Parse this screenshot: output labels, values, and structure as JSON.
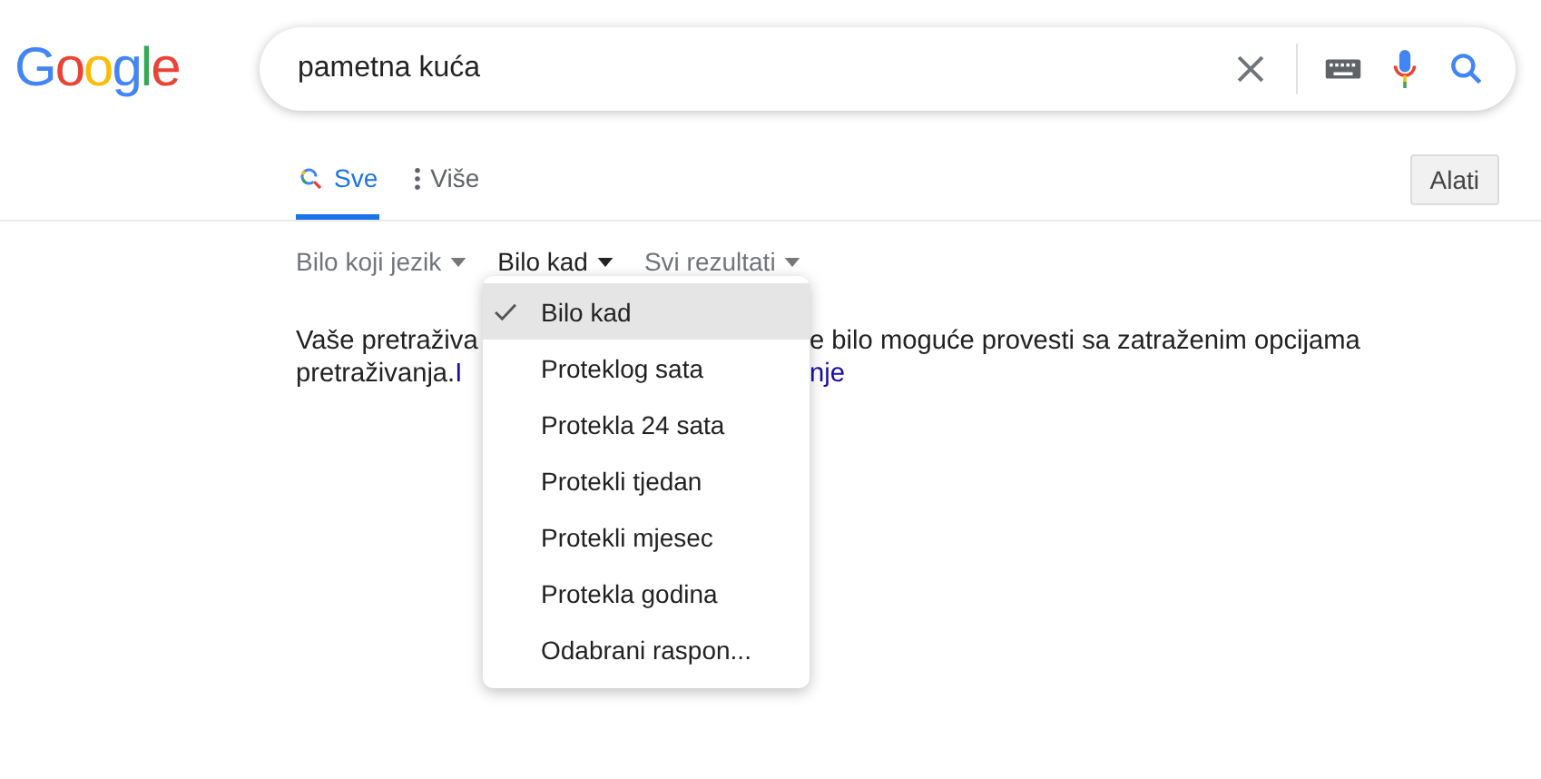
{
  "logo": "Google",
  "search": {
    "value": "pametna kuća"
  },
  "tabs": [
    {
      "label": "Sve",
      "kind": "search",
      "selected": true
    },
    {
      "label": "Više",
      "kind": "more",
      "selected": false
    }
  ],
  "tools_button": "Alati",
  "filters": [
    {
      "label": "Bilo koji jezik",
      "open": false
    },
    {
      "label": "Bilo kad",
      "open": true
    },
    {
      "label": "Svi rezultati",
      "open": false
    }
  ],
  "message": {
    "line_1_left": "Vaše pretraživa",
    "line_1_right": "e bilo moguće provesti sa zatraženim opcijama",
    "line_2_left": "pretraživanja.",
    "line_2_link_left": "I",
    "line_2_link_right": "nje"
  },
  "menu": [
    {
      "label": "Bilo kad",
      "selected": true
    },
    {
      "label": "Proteklog sata",
      "selected": false
    },
    {
      "label": "Protekla 24 sata",
      "selected": false
    },
    {
      "label": "Protekli tjedan",
      "selected": false
    },
    {
      "label": "Protekli mjesec",
      "selected": false
    },
    {
      "label": "Protekla godina",
      "selected": false
    },
    {
      "label": "Odabrani raspon...",
      "selected": false
    }
  ]
}
